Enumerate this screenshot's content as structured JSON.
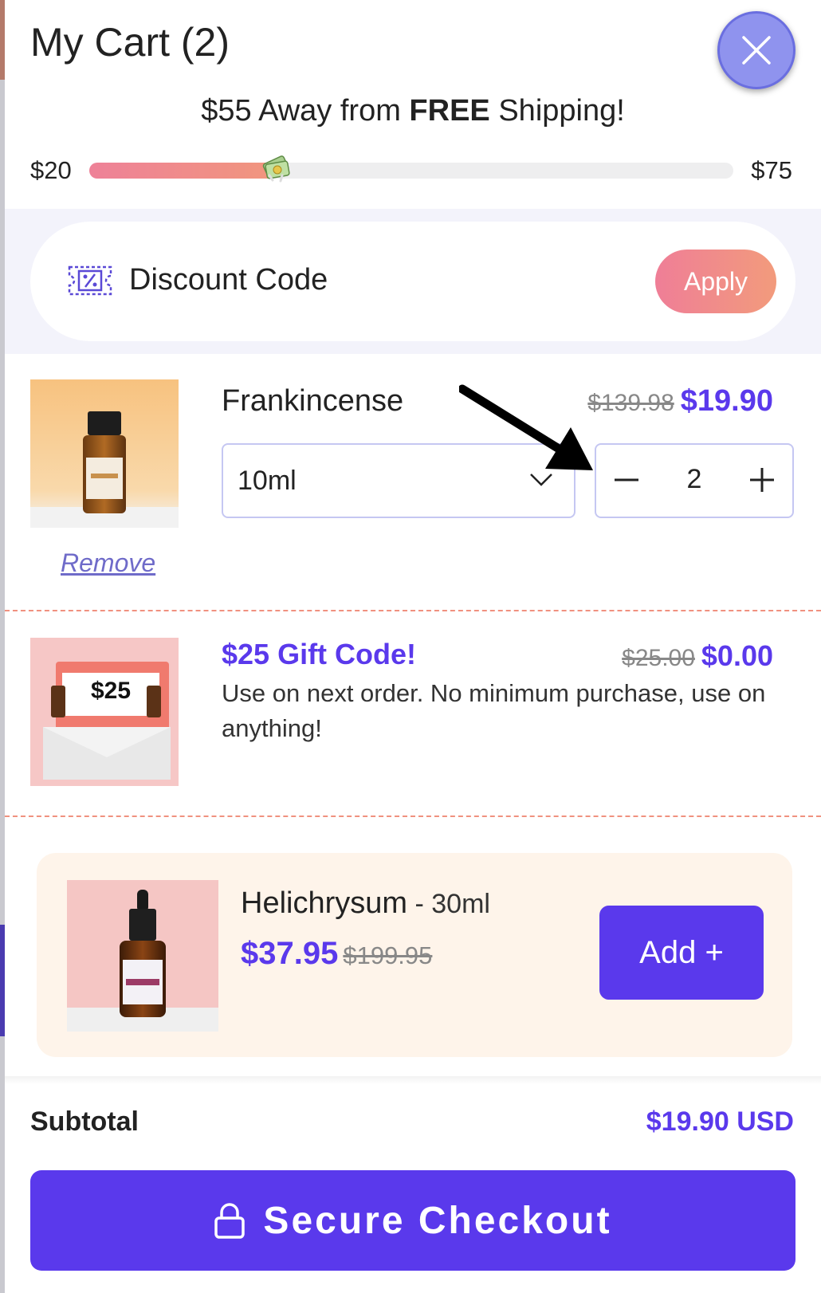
{
  "cart": {
    "title": "My Cart (2)"
  },
  "shipping": {
    "prefix": "$55 Away from ",
    "bold": "FREE",
    "suffix": " Shipping!",
    "min_label": "$20",
    "max_label": "$75",
    "progress_fraction": 0.29
  },
  "discount": {
    "label": "Discount Code",
    "apply_label": "Apply"
  },
  "items": [
    {
      "name": "Frankincense",
      "old_price": "$139.98",
      "price": "$19.90",
      "size": "10ml",
      "quantity": "2",
      "remove_label": "Remove"
    },
    {
      "name": "$25 Gift Code!",
      "old_price": "$25.00",
      "price": "$0.00",
      "description": "Use on next order. No minimum purchase, use on anything!",
      "image_text": "$25"
    }
  ],
  "upsell": {
    "name": "Helichrysum",
    "variant": " - 30ml",
    "price": "$37.95",
    "old_price": "$199.95",
    "add_label": "Add +"
  },
  "footer": {
    "subtotal_label": "Subtotal",
    "subtotal_value": "$19.90 USD",
    "checkout_label": "Secure Checkout"
  },
  "colors": {
    "accent": "#5a39ec",
    "gradient_start": "#ee8198",
    "gradient_end": "#f29b7c"
  },
  "icons": [
    "close-icon",
    "ticket-percent-icon",
    "chevron-down-icon",
    "minus-icon",
    "plus-icon",
    "lock-icon",
    "arrow-annotation"
  ]
}
